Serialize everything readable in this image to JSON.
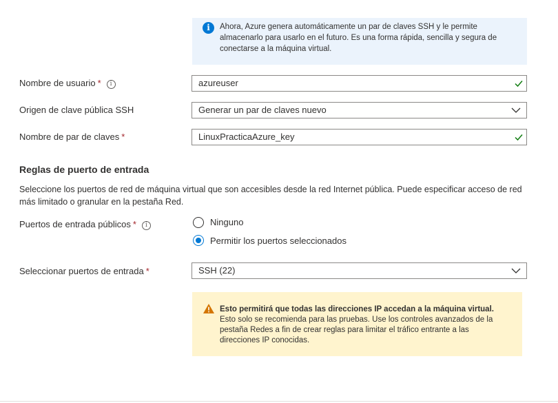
{
  "info_banner": {
    "icon": "info-icon",
    "text": "Ahora, Azure genera automáticamente un par de claves SSH y le permite almacenarlo para usarlo en el futuro. Es una forma rápida, sencilla y segura de conectarse a la máquina virtual."
  },
  "username": {
    "label": "Nombre de usuario",
    "required": "*",
    "value": "azureuser",
    "valid": true
  },
  "ssh_source": {
    "label": "Origen de clave pública SSH",
    "value": "Generar un par de claves nuevo"
  },
  "key_pair": {
    "label": "Nombre de par de claves",
    "required": "*",
    "value": "LinuxPracticaAzure_key",
    "valid": true
  },
  "inbound_rules": {
    "title": "Reglas de puerto de entrada",
    "description": "Seleccione los puertos de red de máquina virtual que son accesibles desde la red Internet pública. Puede especificar acceso de red más limitado o granular en la pestaña Red."
  },
  "public_ports": {
    "label": "Puertos de entrada públicos",
    "required": "*",
    "options": [
      {
        "label": "Ninguno",
        "selected": false
      },
      {
        "label": "Permitir los puertos seleccionados",
        "selected": true
      }
    ]
  },
  "select_ports": {
    "label": "Seleccionar puertos de entrada",
    "required": "*",
    "value": "SSH (22)"
  },
  "warning": {
    "icon": "warning-icon",
    "title": "Esto permitirá que todas las direcciones IP accedan a la máquina virtual.",
    "body": "Esto solo se recomienda para las pruebas.  Use los controles avanzados de la pestaña Redes a fin de crear reglas para limitar el tráfico entrante a las direcciones IP conocidas."
  },
  "colors": {
    "accent": "#0078d4",
    "success": "#107c10",
    "warning": "#d47500",
    "required": "#a4262c"
  }
}
